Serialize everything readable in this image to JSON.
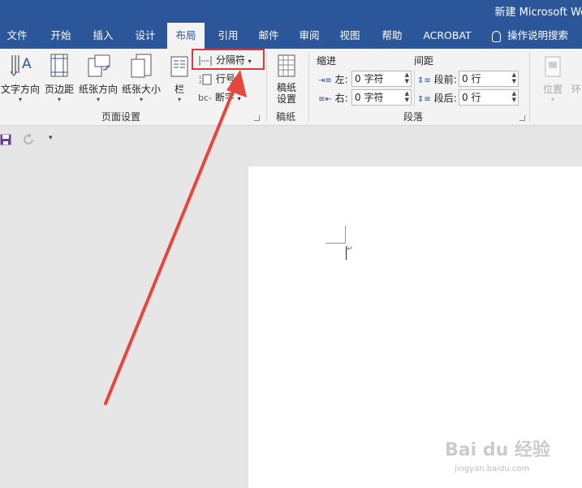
{
  "window": {
    "title": "新建 Microsoft Wo"
  },
  "tabs": [
    {
      "label": "文件"
    },
    {
      "label": "开始"
    },
    {
      "label": "插入"
    },
    {
      "label": "设计"
    },
    {
      "label": "布局"
    },
    {
      "label": "引用"
    },
    {
      "label": "邮件"
    },
    {
      "label": "审阅"
    },
    {
      "label": "视图"
    },
    {
      "label": "帮助"
    },
    {
      "label": "ACROBAT"
    }
  ],
  "active_tab": "布局",
  "tell_me": {
    "label": "操作说明搜索"
  },
  "page_setup": {
    "text_direction": "文字方向",
    "margins": "页边距",
    "orientation": "纸张方向",
    "size": "纸张大小",
    "columns": "栏",
    "breaks": "分隔符",
    "line_numbers": "行号",
    "hyphenation": "断字",
    "group_label": "页面设置"
  },
  "manuscript": {
    "button": "稿纸\n设置",
    "group_label": "稿纸"
  },
  "paragraph": {
    "indent_header": "缩进",
    "spacing_header": "间距",
    "left_label": "左:",
    "left_value": "0 字符",
    "right_label": "右:",
    "right_value": "0 字符",
    "before_label": "段前:",
    "before_value": "0 行",
    "after_label": "段后:",
    "after_value": "0 行",
    "group_label": "段落"
  },
  "arrange": {
    "position": "位置",
    "wrap": "环"
  },
  "watermark": {
    "main": "Bai du 经验",
    "sub": "jingyan.baidu.com"
  },
  "colors": {
    "brand": "#2b579a",
    "highlight": "#d9373e",
    "arrow": "#e8453c"
  }
}
